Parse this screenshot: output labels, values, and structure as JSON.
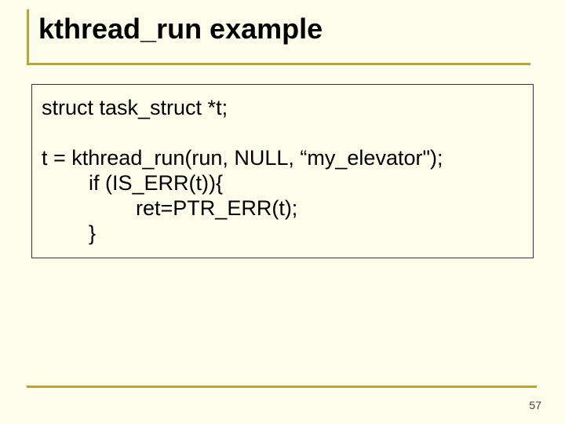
{
  "slide": {
    "title": "kthread_run example",
    "code": {
      "l1": "struct task_struct *t;",
      "l2": "t = kthread_run(run, NULL, “my_elevator\");",
      "l3": "        if (IS_ERR(t)){",
      "l4": "                ret=PTR_ERR(t);",
      "l5": "        }"
    },
    "page_number": "57"
  }
}
